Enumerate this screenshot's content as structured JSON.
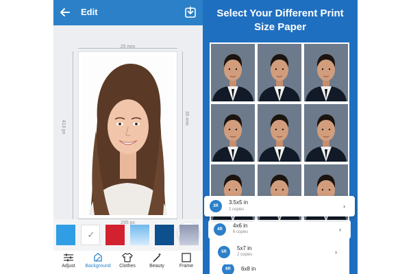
{
  "editor": {
    "title": "Edit",
    "dimensions": {
      "width_mm": "25 mm",
      "height_px": "413 px",
      "height_mm": "35 mm",
      "width_px": "295 px"
    },
    "background_swatches": [
      {
        "name": "sky-blue",
        "color": "#2f9ee4",
        "selected": false
      },
      {
        "name": "white",
        "color": "#ffffff",
        "selected": true
      },
      {
        "name": "red",
        "color": "#d3222f",
        "selected": false
      },
      {
        "name": "gradient-blue",
        "color": "#6fb8ee",
        "selected": false
      },
      {
        "name": "navy",
        "color": "#0e4f8e",
        "selected": false
      },
      {
        "name": "gradient-grey",
        "color": "#8e97b1",
        "selected": false
      }
    ],
    "tools": [
      {
        "label": "Adjust",
        "icon": "sliders-icon",
        "active": false
      },
      {
        "label": "Background",
        "icon": "background-icon",
        "active": true
      },
      {
        "label": "Clothes",
        "icon": "shirt-icon",
        "active": false
      },
      {
        "label": "Beauty",
        "icon": "magic-wand-icon",
        "active": false
      },
      {
        "label": "Frame",
        "icon": "frame-icon",
        "active": false
      }
    ]
  },
  "print": {
    "title_line1": "Select Your Different Print",
    "title_line2": "Size Paper",
    "sizes": [
      {
        "badge": "3R",
        "name": "3.5x5 in",
        "copies": "2 copies"
      },
      {
        "badge": "4R",
        "name": "4x6 in",
        "copies": "6 copies"
      },
      {
        "badge": "5R",
        "name": "5x7 in",
        "copies": "2 copies"
      },
      {
        "badge": "6R",
        "name": "6x8 in",
        "copies": ""
      }
    ]
  },
  "colors": {
    "accent": "#2b80c8",
    "panel_blue": "#1f6fc0"
  }
}
